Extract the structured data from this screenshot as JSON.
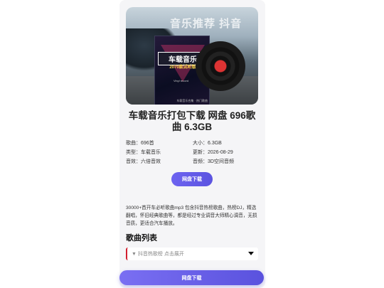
{
  "cover": {
    "watermark": "音乐推荐 抖音",
    "album_title": "车载音乐",
    "album_subtitle": "2070款试听版",
    "album_record": "Vinyl record",
    "album_footer": "车载音乐合集 · 热门歌曲"
  },
  "title": "车载音乐打包下载 网盘 696歌曲 6.3GB",
  "info": {
    "rows": [
      [
        "歌曲：696首",
        "大小：6.3GB"
      ],
      [
        "类型：车载音乐",
        "更新：2026-08-29"
      ],
      [
        "音效：六倍音效",
        "音频：3D空间音频"
      ]
    ]
  },
  "download_label": "网盘下载",
  "description": "30000+首开车必听歌曲mp3 包含抖音热榜歌曲，热榜DJ，精选翻唱，怀旧经典歌曲等，都是经过专业调音大师精心调音，无损音质，更适合汽车播放。",
  "song_list": {
    "heading": "歌曲列表",
    "dropdown_label": "▼ 抖音热歌榜 点击展开"
  },
  "footer_label": "网盘下载",
  "colors": {
    "accent": "#5b53e0",
    "marker": "#d21e2f"
  }
}
